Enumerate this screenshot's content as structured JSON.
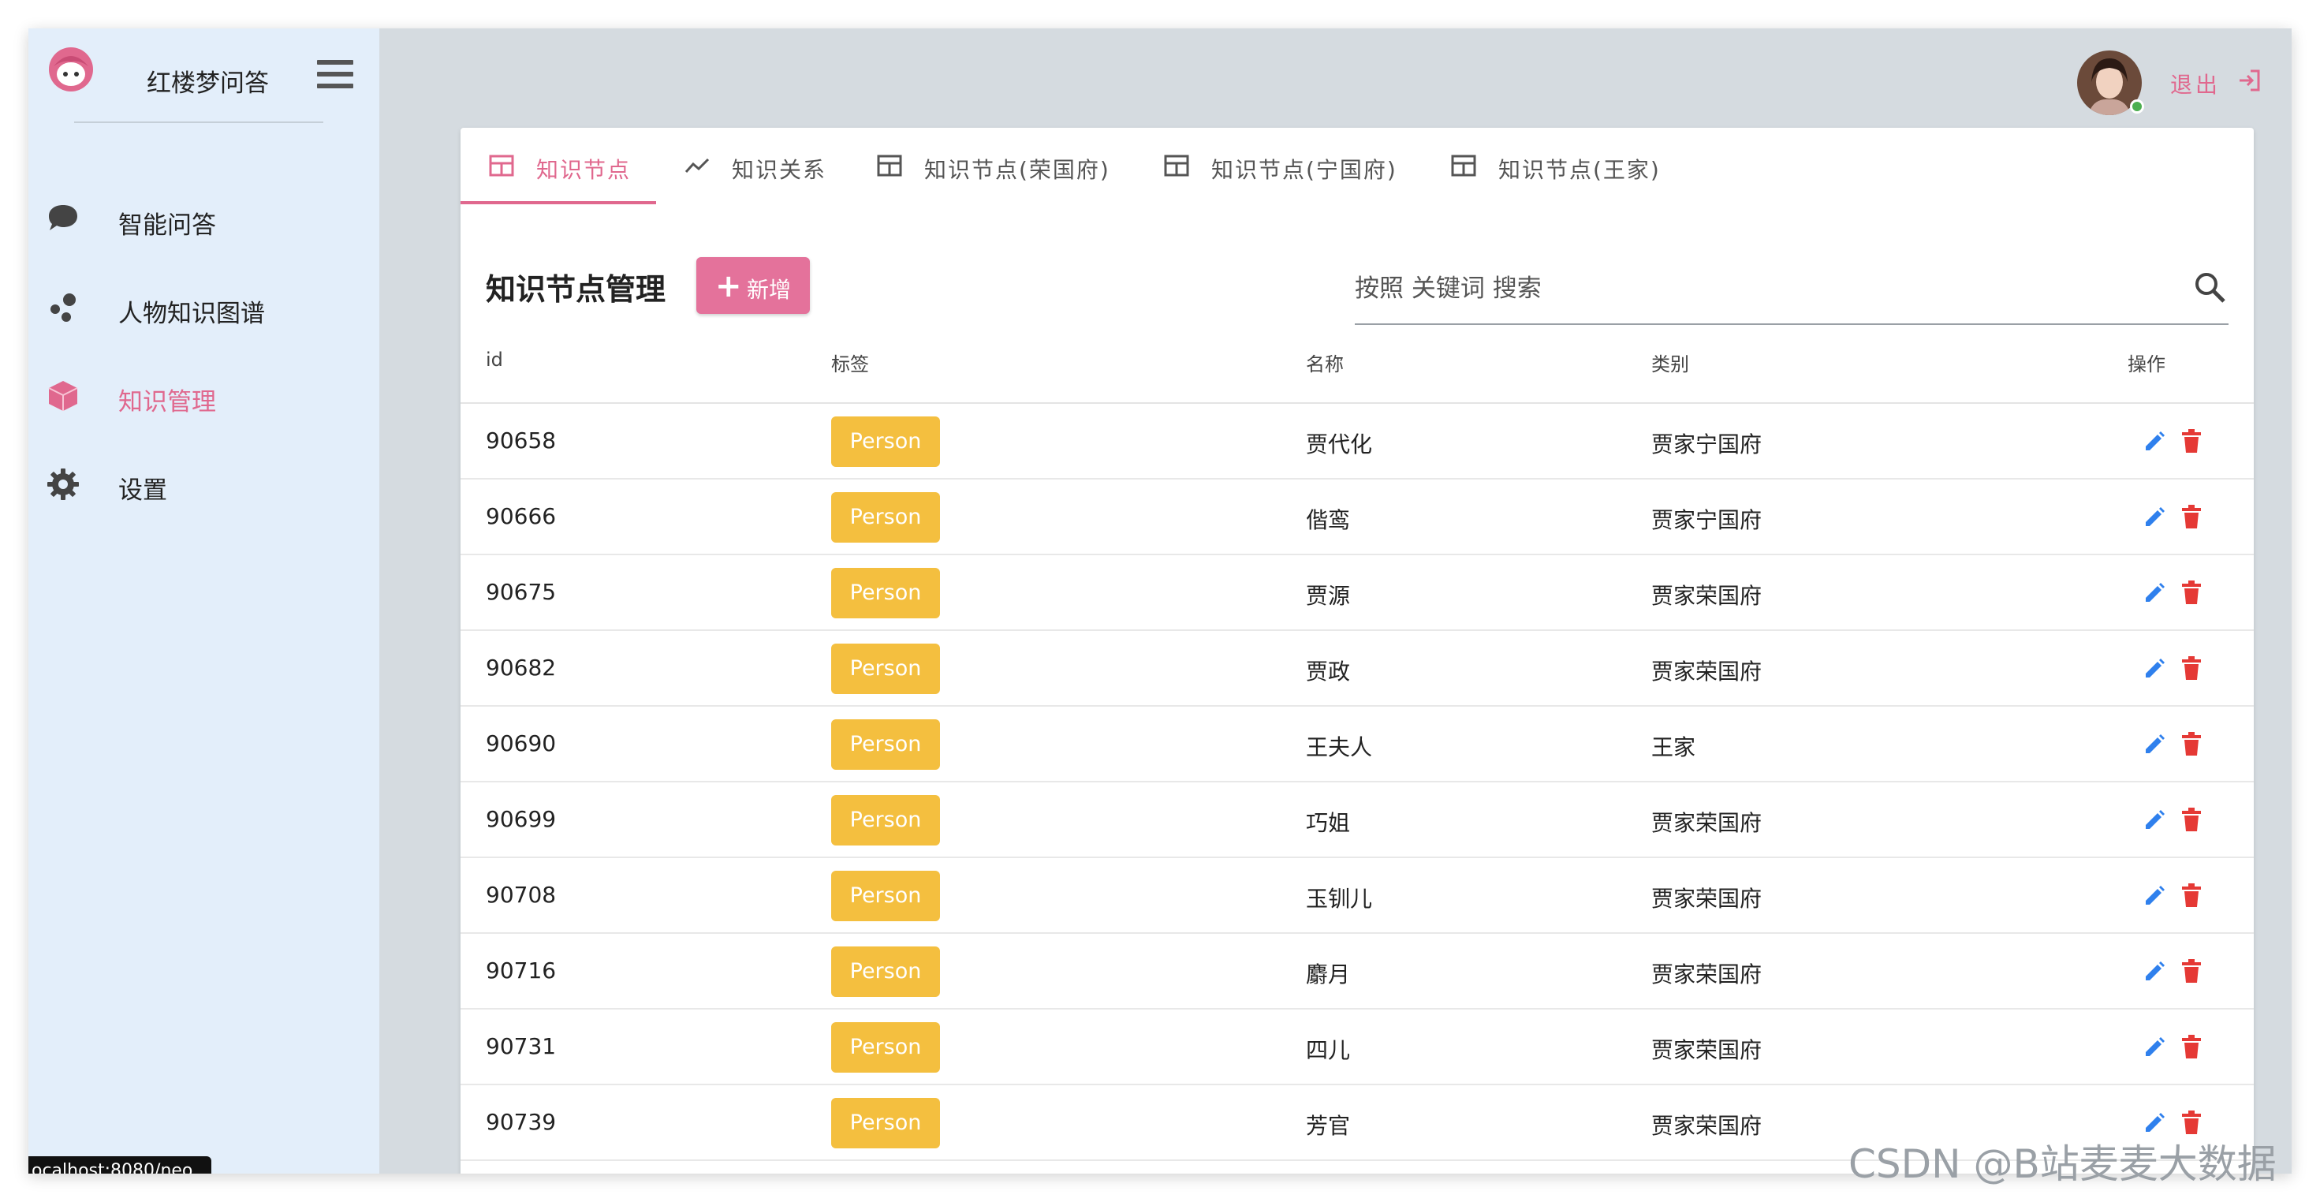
{
  "sidebar": {
    "title": "红楼梦问答",
    "items": [
      {
        "label": "智能问答",
        "icon": "chat-bubble-icon"
      },
      {
        "label": "人物知识图谱",
        "icon": "graph-nodes-icon"
      },
      {
        "label": "知识管理",
        "icon": "cube-icon",
        "active": true
      },
      {
        "label": "设置",
        "icon": "gear-icon"
      }
    ]
  },
  "header": {
    "logout_label": "退出"
  },
  "tabs": [
    {
      "label": "知识节点",
      "icon": "table-icon",
      "active": true
    },
    {
      "label": "知识关系",
      "icon": "trending-icon"
    },
    {
      "label": "知识节点(荣国府)",
      "icon": "table-icon"
    },
    {
      "label": "知识节点(宁国府)",
      "icon": "table-icon"
    },
    {
      "label": "知识节点(王家)",
      "icon": "table-icon"
    }
  ],
  "main": {
    "title": "知识节点管理",
    "add_label": "新增",
    "search_placeholder": "按照 关键词 搜索"
  },
  "table": {
    "columns": [
      "id",
      "标签",
      "名称",
      "类别",
      "操作"
    ],
    "rows": [
      {
        "id": "90658",
        "tag": "Person",
        "name": "贾代化",
        "category": "贾家宁国府"
      },
      {
        "id": "90666",
        "tag": "Person",
        "name": "偕鸾",
        "category": "贾家宁国府"
      },
      {
        "id": "90675",
        "tag": "Person",
        "name": "贾源",
        "category": "贾家荣国府"
      },
      {
        "id": "90682",
        "tag": "Person",
        "name": "贾政",
        "category": "贾家荣国府"
      },
      {
        "id": "90690",
        "tag": "Person",
        "name": "王夫人",
        "category": "王家"
      },
      {
        "id": "90699",
        "tag": "Person",
        "name": "巧姐",
        "category": "贾家荣国府"
      },
      {
        "id": "90708",
        "tag": "Person",
        "name": "玉钏儿",
        "category": "贾家荣国府"
      },
      {
        "id": "90716",
        "tag": "Person",
        "name": "麝月",
        "category": "贾家荣国府"
      },
      {
        "id": "90731",
        "tag": "Person",
        "name": "四儿",
        "category": "贾家荣国府"
      },
      {
        "id": "90739",
        "tag": "Person",
        "name": "芳官",
        "category": "贾家荣国府"
      }
    ]
  },
  "status_bar": {
    "url": "ocalhost:8080/neo"
  },
  "watermark": {
    "credit": "CSDN @B站麦麦大数据"
  },
  "colors": {
    "accent": "#e0688e",
    "badge": "#f4bf3f",
    "edit": "#2f80ed",
    "delete": "#e53935",
    "sidebar_bg": "#e3eefa"
  }
}
